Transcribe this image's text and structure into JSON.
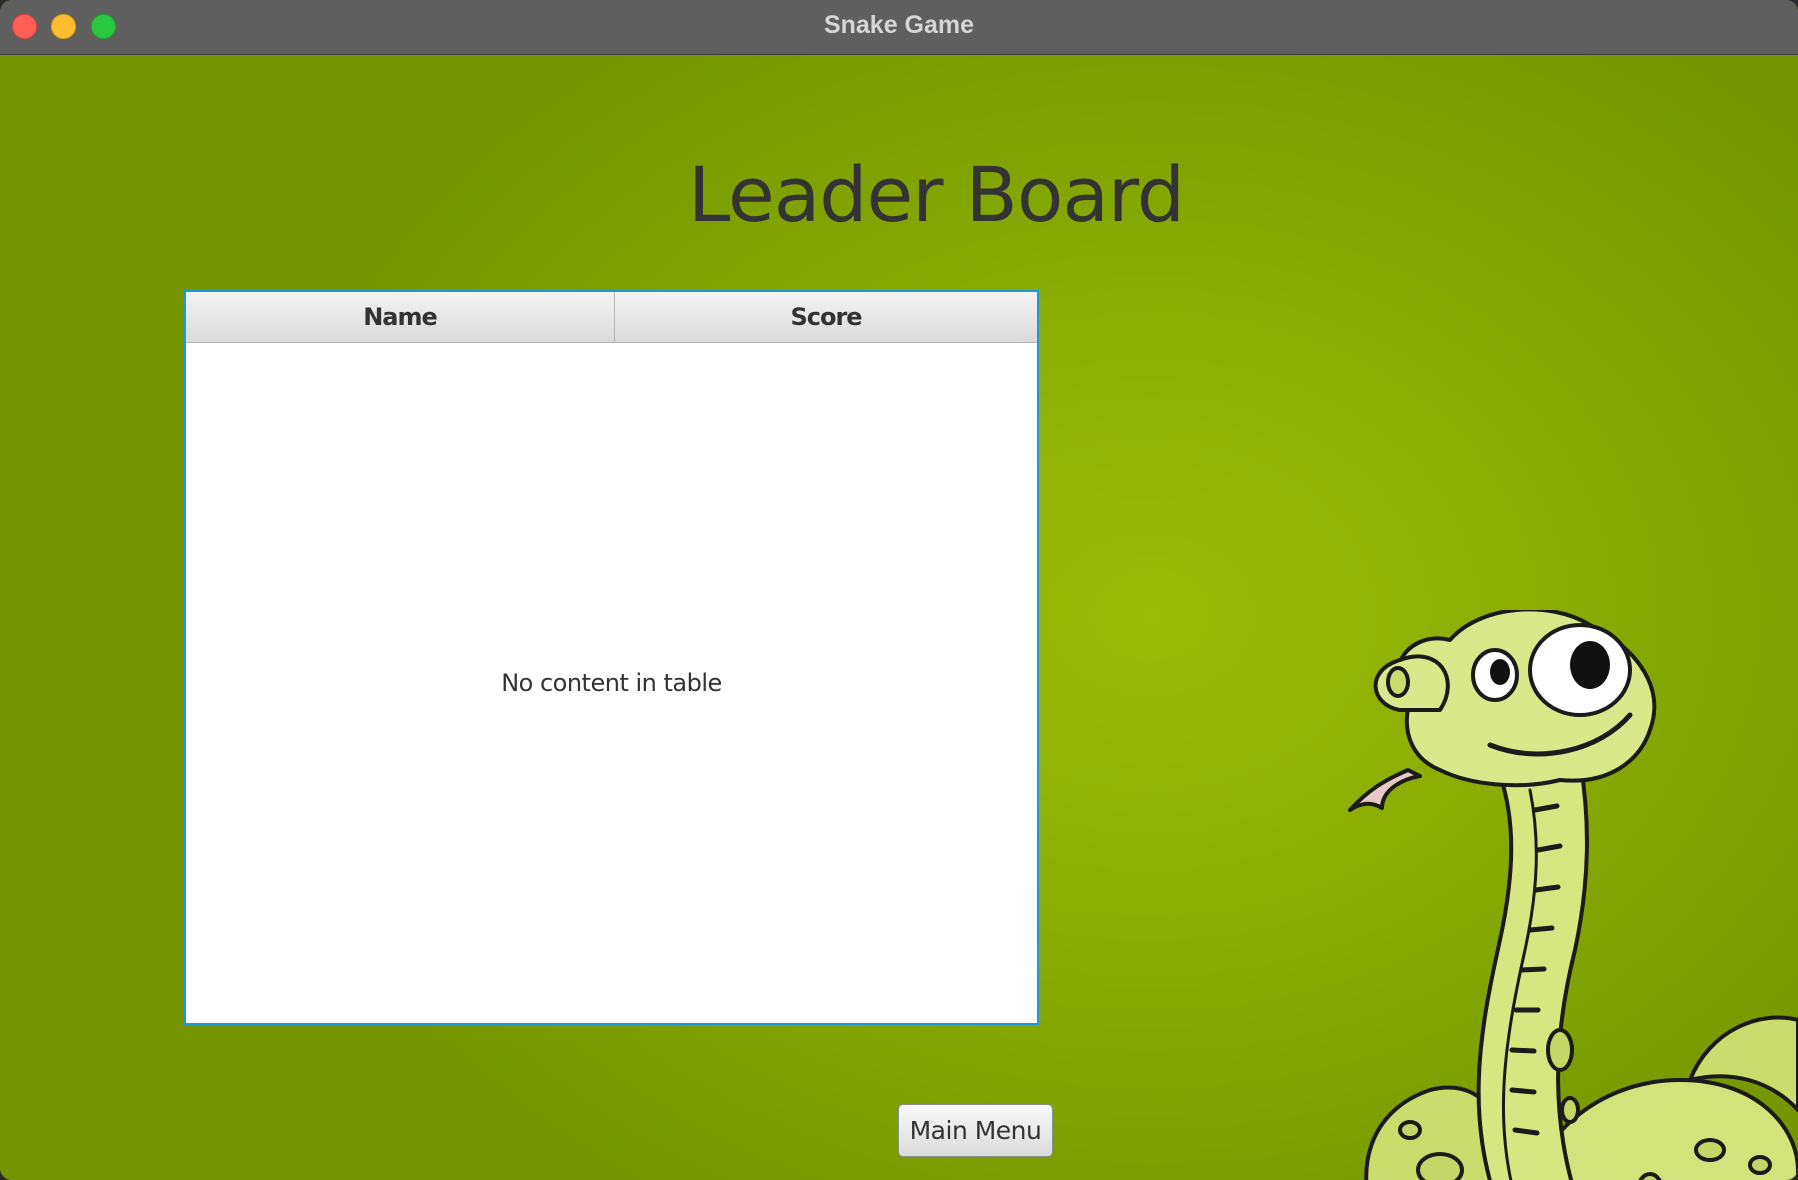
{
  "window": {
    "title": "Snake Game"
  },
  "page": {
    "heading": "Leader Board"
  },
  "leaderboard": {
    "columns": [
      "Name",
      "Score"
    ],
    "rows": [],
    "empty_text": "No content in table"
  },
  "footer": {
    "main_menu_label": "Main Menu"
  },
  "colors": {
    "background": "#8aac04",
    "table_focus_border": "#1a9bd7",
    "snake_body": "#cfe07a"
  }
}
